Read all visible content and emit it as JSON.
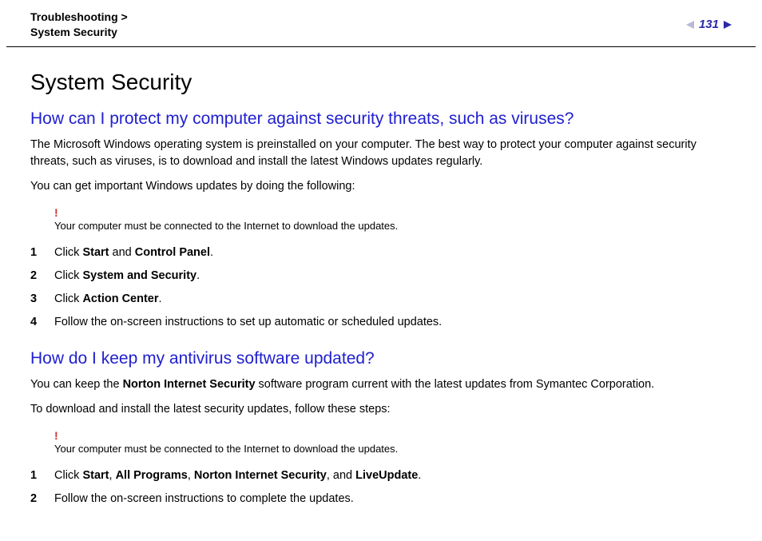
{
  "header": {
    "breadcrumb_line1": "Troubleshooting >",
    "breadcrumb_line2": "System Security",
    "page_number": "131"
  },
  "title": "System Security",
  "section1": {
    "heading": "How can I protect my computer against security threats, such as viruses?",
    "para1": "The Microsoft Windows operating system is preinstalled on your computer. The best way to protect your computer against security threats, such as viruses, is to download and install the latest Windows updates regularly.",
    "para2": "You can get important Windows updates by doing the following:",
    "note_bang": "!",
    "note_text": "Your computer must be connected to the Internet to download the updates.",
    "steps": [
      {
        "num": "1",
        "pre": "Click ",
        "b1": "Start",
        "mid1": " and ",
        "b2": "Control Panel",
        "post": "."
      },
      {
        "num": "2",
        "pre": "Click ",
        "b1": "System and Security",
        "post": "."
      },
      {
        "num": "3",
        "pre": "Click ",
        "b1": "Action Center",
        "post": "."
      },
      {
        "num": "4",
        "pre": "Follow the on-screen instructions to set up automatic or scheduled updates."
      }
    ]
  },
  "section2": {
    "heading": "How do I keep my antivirus software updated?",
    "para1_pre": "You can keep the ",
    "para1_b": "Norton Internet Security",
    "para1_post": " software program current with the latest updates from Symantec Corporation.",
    "para2": "To download and install the latest security updates, follow these steps:",
    "note_bang": "!",
    "note_text": "Your computer must be connected to the Internet to download the updates.",
    "steps": [
      {
        "num": "1",
        "pre": "Click ",
        "b1": "Start",
        "mid1": ", ",
        "b2": "All Programs",
        "mid2": ", ",
        "b3": "Norton Internet Security",
        "mid3": ", and ",
        "b4": "LiveUpdate",
        "post": "."
      },
      {
        "num": "2",
        "pre": "Follow the on-screen instructions to complete the updates."
      }
    ]
  }
}
